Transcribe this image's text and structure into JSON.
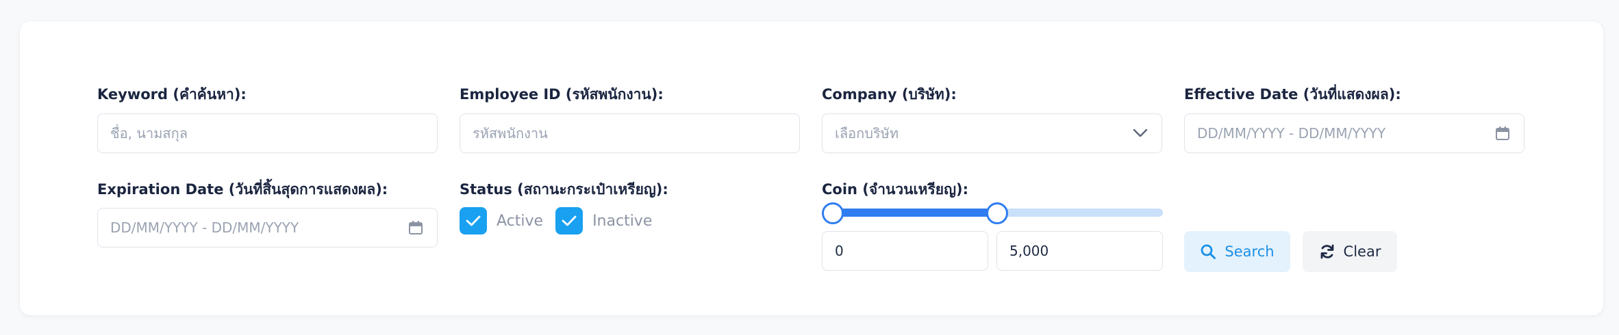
{
  "form": {
    "keyword": {
      "label": "Keyword (คำค้นหา):",
      "placeholder": "ชื่อ, นามสกุล"
    },
    "employee_id": {
      "label": "Employee ID (รหัสพนักงาน):",
      "placeholder": "รหัสพนักงาน"
    },
    "company": {
      "label": "Company (บริษัท):",
      "placeholder": "เลือกบริษัท"
    },
    "effective_date": {
      "label": "Effective Date (วันที่แสดงผล):",
      "placeholder": "DD/MM/YYYY - DD/MM/YYYY"
    },
    "expiration_date": {
      "label": "Expiration Date (วันที่สิ้นสุดการแสดงผล):",
      "placeholder": "DD/MM/YYYY - DD/MM/YYYY"
    },
    "status": {
      "label": "Status (สถานะกระเป๋าเหรียญ):",
      "options": [
        {
          "label": "Active",
          "checked": true
        },
        {
          "label": "Inactive",
          "checked": true
        }
      ]
    },
    "coin": {
      "label": "Coin (จำนวนเหรียญ):",
      "min_value": "0",
      "max_value": "5,000",
      "range_selected_fraction": 0.5
    }
  },
  "actions": {
    "search_label": "Search",
    "clear_label": "Clear"
  },
  "colors": {
    "accent": "#2f7df0",
    "checkbox": "#1aa0f0",
    "search_bg": "#e4f2fd",
    "search_text": "#1b8fe6",
    "slider_track": "#c9dffa"
  },
  "icons": {
    "calendar": "calendar-icon",
    "chevron": "chevron-down-icon",
    "search": "search-icon",
    "refresh": "refresh-icon",
    "check": "check-icon"
  }
}
